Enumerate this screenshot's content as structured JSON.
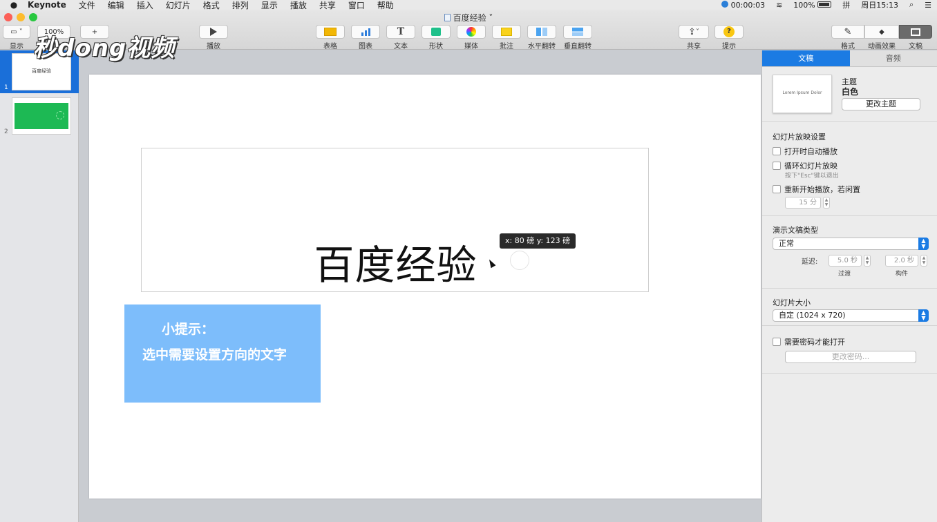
{
  "menubar": {
    "apple": "",
    "app_name": "Keynote",
    "items": [
      "文件",
      "编辑",
      "插入",
      "幻灯片",
      "格式",
      "排列",
      "显示",
      "播放",
      "共享",
      "窗口",
      "帮助"
    ],
    "timer": "00:00:03",
    "battery": "100%",
    "input_method": "拼",
    "clock": "周日15:13",
    "search_glyph": "⌕",
    "menu_glyph": "☰"
  },
  "window": {
    "title": "百度经验"
  },
  "toolbar": {
    "view_label": "显示",
    "zoom_value": "100%",
    "zoom_label": "缩放",
    "add_glyph": "+",
    "play_label": "播放",
    "table_label": "表格",
    "chart_label": "图表",
    "text_label": "文本",
    "text_glyph": "T",
    "shape_label": "形状",
    "media_label": "媒体",
    "comment_label": "批注",
    "flip_h_label": "水平翻转",
    "flip_v_label": "垂直翻转",
    "share_label": "共享",
    "share_glyph": "⇪",
    "tips_label": "提示",
    "tips_glyph": "?",
    "format_label": "格式",
    "format_glyph": "✎",
    "animate_label": "动画效果",
    "animate_glyph": "◆",
    "document_label": "文稿"
  },
  "watermark": "秒dong视频",
  "navigator": {
    "slides": [
      {
        "number": "1",
        "title": "百度经验",
        "selected": true
      },
      {
        "number": "2",
        "title": "",
        "selected": false
      }
    ]
  },
  "slide": {
    "title": "百度经验",
    "tooltip": "x: 80 磅  y: 123 磅",
    "tip_line1": "小提示：",
    "tip_line2": "选中需要设置方向的文字"
  },
  "inspector": {
    "tabs": [
      "文稿",
      "音频"
    ],
    "active_tab": "文稿",
    "theme_preview_text": "Lorem Ipsum Dolor",
    "theme_label": "主题",
    "theme_name": "白色",
    "change_theme_button": "更改主题",
    "slideshow_settings_title": "幻灯片放映设置",
    "autoplay_label": "打开时自动播放",
    "loop_label": "循环幻灯片放映",
    "loop_hint": "按下\"Esc\"键以退出",
    "restart_label": "重新开始播放，若闲置",
    "idle_value": "15 分",
    "presentation_type_title": "演示文稿类型",
    "presentation_type_value": "正常",
    "delay_label": "延迟:",
    "transition_delay": "5.0 秒",
    "transition_label": "过渡",
    "build_delay": "2.0 秒",
    "build_label": "构件",
    "slide_size_title": "幻灯片大小",
    "slide_size_value": "自定 (1024 x 720)",
    "password_label": "需要密码才能打开",
    "change_password_button": "更改密码..."
  },
  "colors": {
    "accent": "#1b7be3",
    "tip_box": "#7dbdfb",
    "thumb_green": "#1db954"
  }
}
